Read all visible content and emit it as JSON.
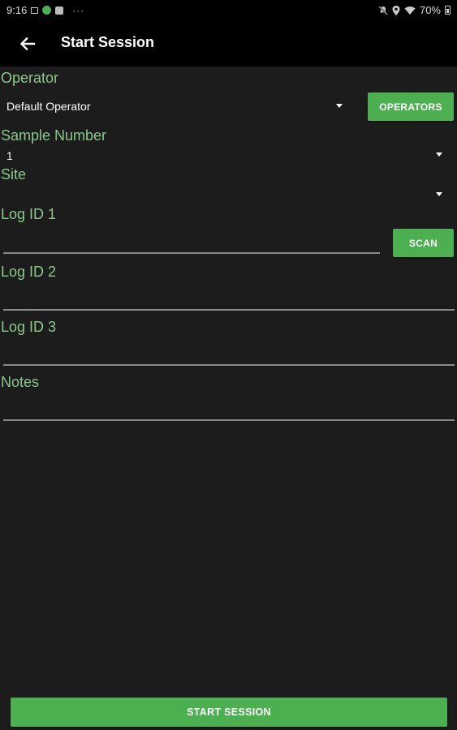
{
  "status_bar": {
    "time": "9:16",
    "overflow": "···",
    "battery": "70%",
    "icons_left": [
      "image-icon",
      "green-app-icon",
      "a-app-icon"
    ],
    "icons_right": [
      "mute-icon",
      "location-icon",
      "wifi-icon",
      "battery-icon"
    ]
  },
  "app_bar": {
    "title": "Start Session",
    "back_icon": "arrow-left-icon"
  },
  "form": {
    "operator": {
      "label": "Operator",
      "value": "Default Operator",
      "button_label": "OPERATORS"
    },
    "sample_number": {
      "label": "Sample Number",
      "value": "1"
    },
    "site": {
      "label": "Site",
      "value": ""
    },
    "log_id_1": {
      "label": "Log ID 1",
      "value": "",
      "button_label": "SCAN"
    },
    "log_id_2": {
      "label": "Log ID 2",
      "value": ""
    },
    "log_id_3": {
      "label": "Log ID 3",
      "value": ""
    },
    "notes": {
      "label": "Notes",
      "value": ""
    }
  },
  "footer": {
    "start_button_label": "START SESSION"
  },
  "colors": {
    "accent": "#4caf50",
    "label": "#8bc98a",
    "background": "#1c1c1c",
    "bar": "#000000"
  }
}
